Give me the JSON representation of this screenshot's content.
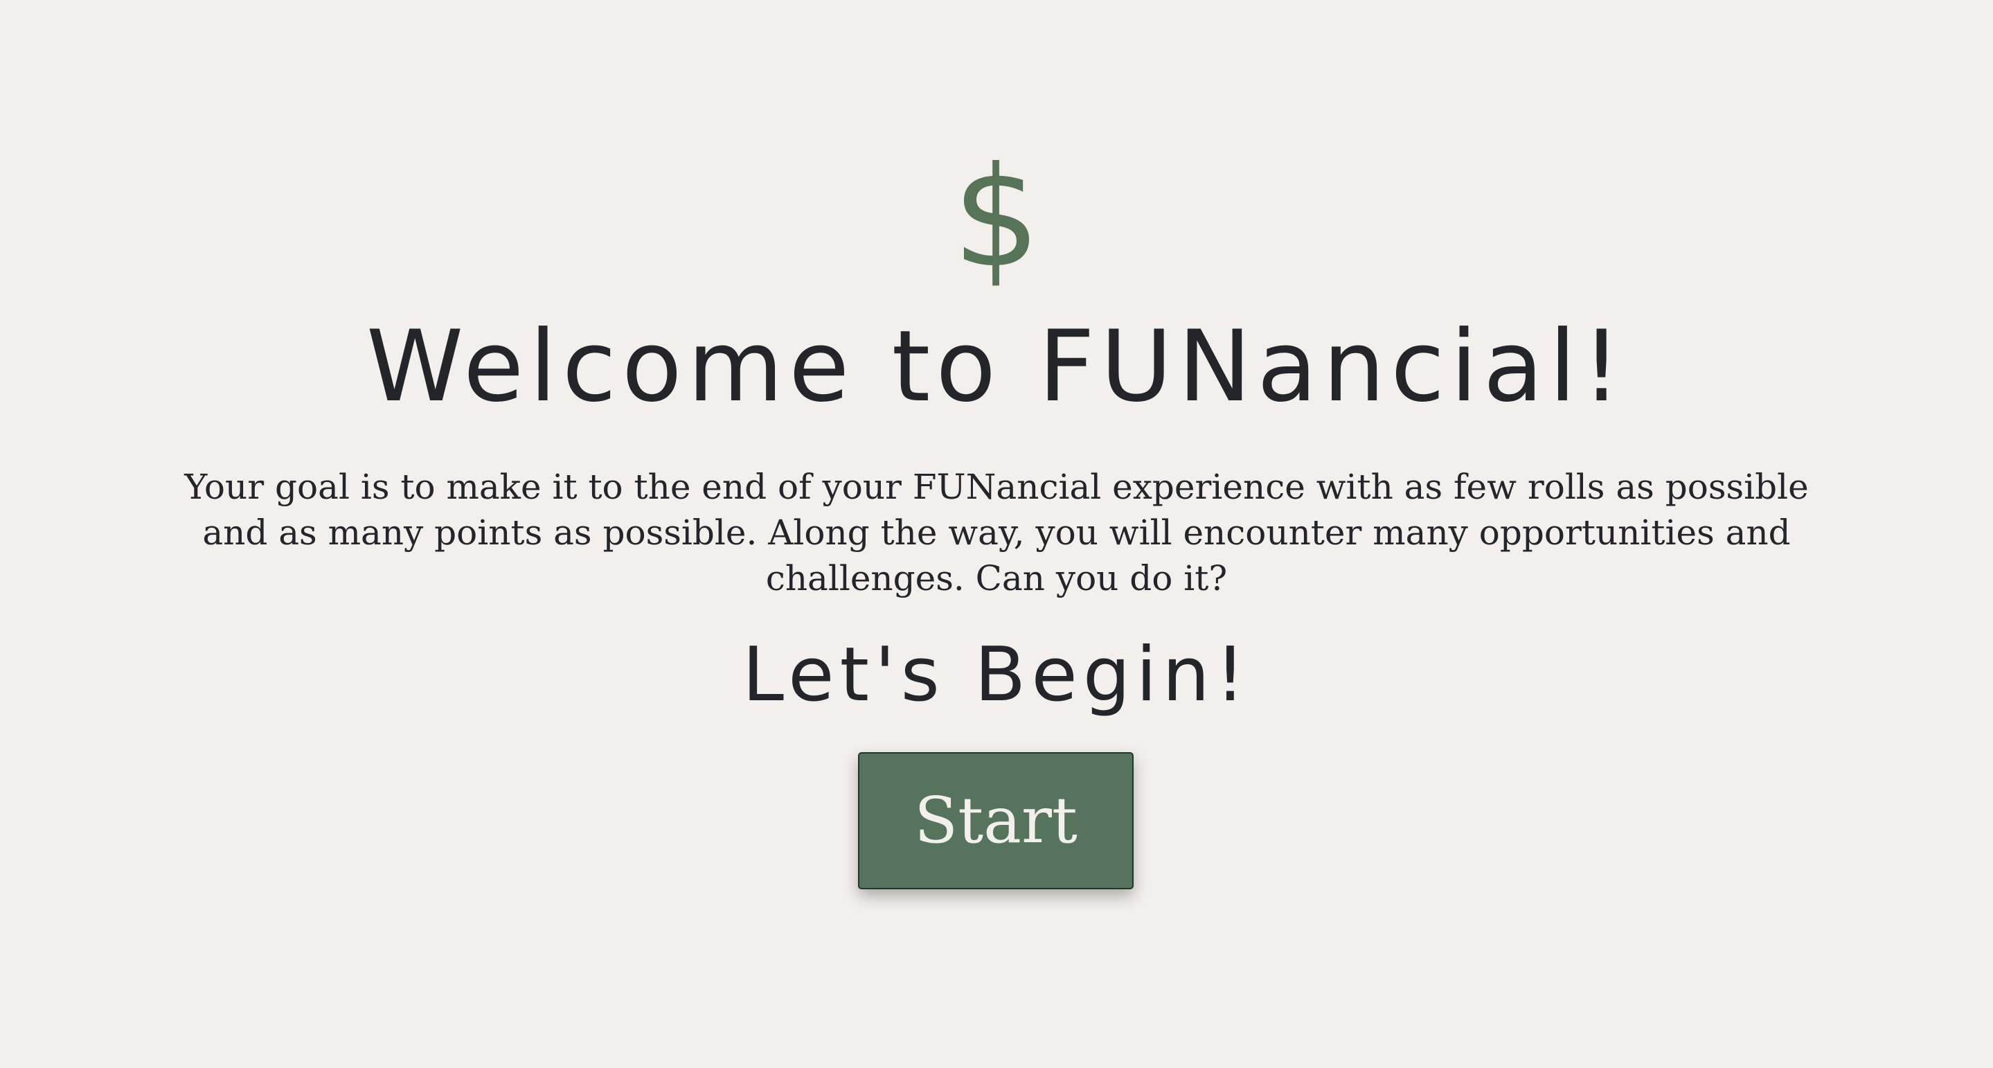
{
  "app": {
    "logo_symbol": "$",
    "title": "Welcome to FUNancial!",
    "intro": "Your goal is to make it to the end of your FUNancial experience with as few rolls as possible and as many points as possible. Along the way, you will encounter many opportunities and challenges. Can you do it?",
    "subtitle": "Let's Begin!",
    "start_label": "Start"
  },
  "colors": {
    "background": "#f2efec",
    "accent": "#577458",
    "text": "#23252b",
    "button": "#56745b",
    "button_text": "#f2efec"
  },
  "icons": {
    "logo": "dollar-sign-icon"
  }
}
